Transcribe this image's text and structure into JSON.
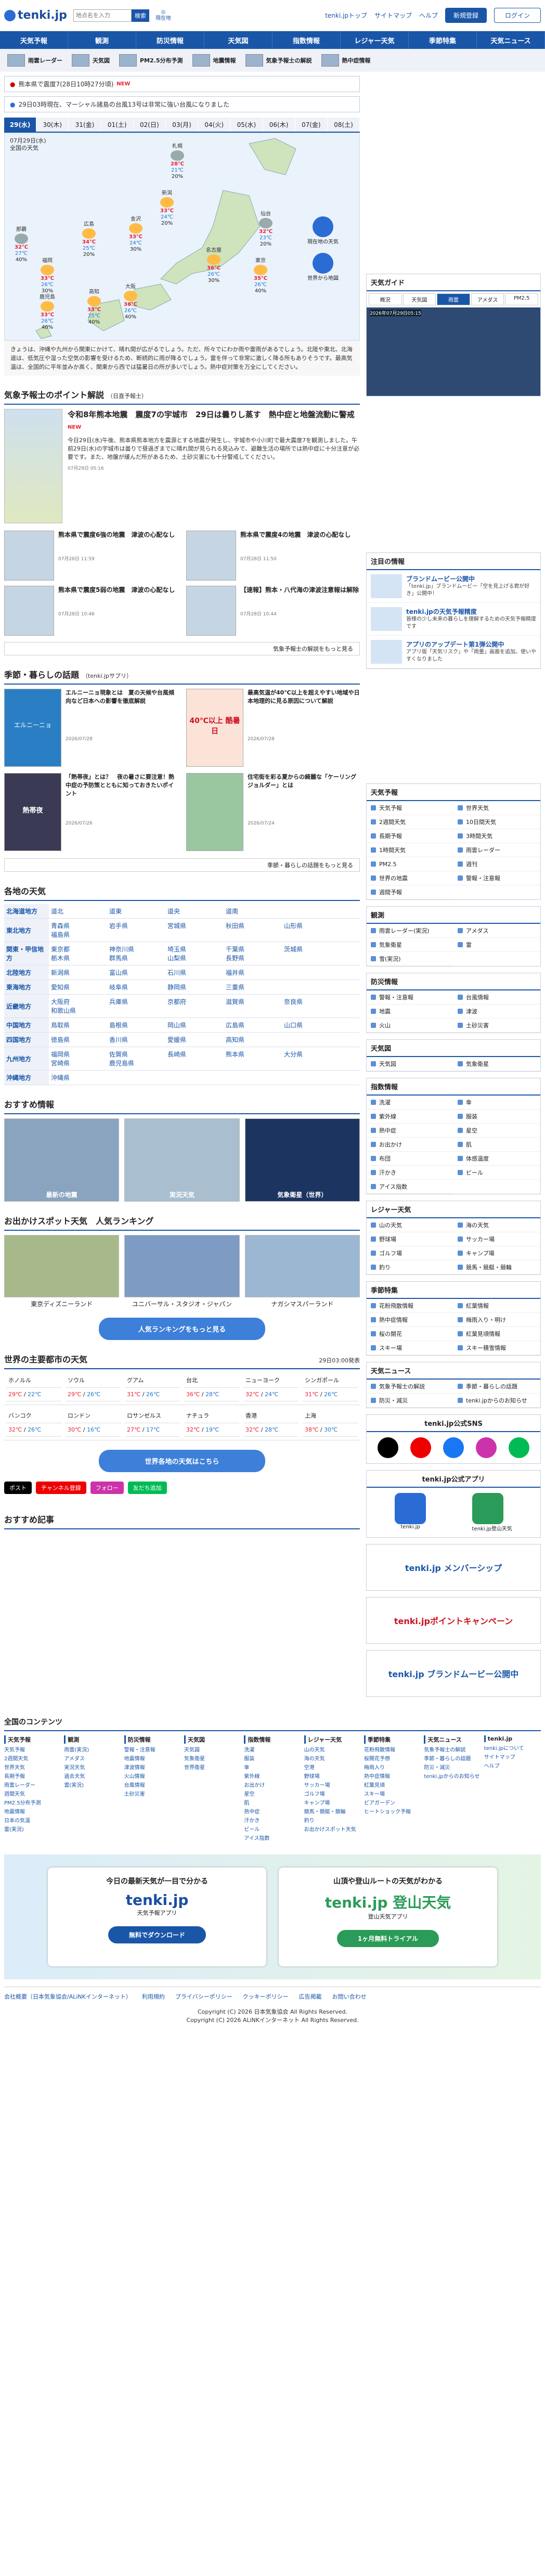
{
  "header": {
    "logo": "tenki.jp",
    "search_placeholder": "地点名を入力",
    "search_button": "検索",
    "current_location": "現在地",
    "links": [
      "tenki.jpトップ",
      "サイトマップ",
      "ヘルプ"
    ],
    "register": "新規登録",
    "login": "ログイン"
  },
  "nav": [
    "天気予報",
    "観測",
    "防災情報",
    "天気図",
    "指数情報",
    "レジャー天気",
    "季節特集",
    "天気ニュース"
  ],
  "subnav": [
    "雨雲レーダー",
    "天気図",
    "PM2.5分布予測",
    "地震情報",
    "気象予報士の解説",
    "熱中症情報"
  ],
  "alerts": [
    {
      "badge": "●",
      "text": "熊本県で震度7(28日10時27分頃)",
      "tag": "NEW"
    },
    {
      "badge": "●",
      "text": "29日03時現在、マーシャル諸島の台風13号は非常に強い台風になりました"
    }
  ],
  "day_tabs": [
    "29(水)",
    "30(木)",
    "31(金)",
    "01(土)",
    "02(日)",
    "03(月)",
    "04(火)",
    "05(水)",
    "06(木)",
    "07(金)",
    "08(土)"
  ],
  "map": {
    "title": "07月29日(水)",
    "subtitle": "全国の天気",
    "cities": [
      {
        "name": "札幌",
        "hi": "28℃",
        "lo": "21℃",
        "pop": "20%"
      },
      {
        "name": "新潟",
        "hi": "33℃",
        "lo": "24℃",
        "pop": "20%"
      },
      {
        "name": "仙台",
        "hi": "32℃",
        "lo": "23℃",
        "pop": "20%"
      },
      {
        "name": "金沢",
        "hi": "33℃",
        "lo": "24℃",
        "pop": "30%"
      },
      {
        "name": "広島",
        "hi": "34℃",
        "lo": "25℃",
        "pop": "20%"
      },
      {
        "name": "名古屋",
        "hi": "36℃",
        "lo": "26℃",
        "pop": "30%"
      },
      {
        "name": "東京",
        "hi": "35℃",
        "lo": "26℃",
        "pop": "40%"
      },
      {
        "name": "福岡",
        "hi": "33℃",
        "lo": "26℃",
        "pop": "30%"
      },
      {
        "name": "大阪",
        "hi": "36℃",
        "lo": "26℃",
        "pop": "40%"
      },
      {
        "name": "高知",
        "hi": "33℃",
        "lo": "25℃",
        "pop": "40%"
      },
      {
        "name": "鹿児島",
        "hi": "33℃",
        "lo": "26℃",
        "pop": "40%"
      },
      {
        "name": "那覇",
        "hi": "32℃",
        "lo": "27℃",
        "pop": "40%"
      }
    ],
    "btn_register": "現在地の天気",
    "btn_world": "世界から地図",
    "note": "きょうは、沖縄や九州から関東にかけて、晴れ間が広がるでしょう。ただ、所々でにわか雨や雷雨があるでしょう。北陸や東北、北海道は、低気圧や湿った空気の影響を受けるため、断続的に雨が降るでしょう。雷を伴って非常に激しく降る所もありそうです。最高気温は、全国的に平年並みか高く、関東から西では猛暑日の所が多いでしょう。熱中症対策を万全にしてください。"
  },
  "forecaster": {
    "title": "気象予報士のポイント解説",
    "sub": "（日直予報士）",
    "feature_title": "令和8年熊本地震　震度7の宇城市　29日は曇りし蒸す　熱中症と地盤流動に警戒",
    "feature_tag": "NEW",
    "feature_text": "今日29日(水)午後、熊本県熊本地方を震源とする地震が発生し、宇城市や小川町で最大震度7を観測しました。午前29日(水)の宇城市は曇りで昼過ぎまでに晴れ間が見られる見込みで、避難生活の場所では熱中症に十分注意が必要です。また、地盤が緩んだ所があるため、土砂災害にも十分警戒してください。",
    "feature_date": "07月29日 05:16",
    "items": [
      {
        "title": "熊本県で震度6強の地震　津波の心配なし",
        "date": "07月28日 11:59"
      },
      {
        "title": "熊本県で震度4の地震　津波の心配なし",
        "date": "07月28日 11:50"
      },
      {
        "title": "熊本県で震度5弱の地震　津波の心配なし",
        "date": "07月28日 10:46"
      },
      {
        "title": "【速報】熊本・八代海の津波注意報は解除",
        "date": "07月28日 10:44"
      }
    ],
    "more": "気象予報士の解説をもっと見る"
  },
  "seasonal": {
    "title": "季節・暮らしの話題",
    "sub": "（tenki.jpサプリ）",
    "items": [
      {
        "title": "エルニーニョ現象とは　夏の天候や台風傾向など日本への影響を徹底解説",
        "date": "2026/07/28"
      },
      {
        "title": "最高気温が40℃以上を超えやすい地域や日本地理的に見る原因について解説",
        "date": "2026/07/28"
      },
      {
        "title": "「熱帯夜」とは？　夜の暑さに要注意！熱中症の予防策とともに知っておきたいポイント",
        "date": "2026/07/26"
      },
      {
        "title": "住宅街を彩る夏からの綺麗な「ケーリングジョルダー」とは",
        "date": "2026/07/24"
      }
    ],
    "img_labels": [
      "エルニーニョ",
      "40℃以上 酷暑日",
      "熱帯夜",
      ""
    ],
    "more": "季節・暮らしの話題をもっと見る"
  },
  "regions": {
    "title": "各地の天気",
    "rows": [
      {
        "area": "北海道地方",
        "prefs": [
          "道北",
          "道東",
          "道央",
          "道南"
        ]
      },
      {
        "area": "東北地方",
        "prefs": [
          "青森県",
          "岩手県",
          "宮城県",
          "秋田県",
          "山形県",
          "福島県"
        ]
      },
      {
        "area": "関東・甲信地方",
        "prefs": [
          "東京都",
          "神奈川県",
          "埼玉県",
          "千葉県",
          "茨城県",
          "栃木県",
          "群馬県",
          "山梨県",
          "長野県"
        ]
      },
      {
        "area": "北陸地方",
        "prefs": [
          "新潟県",
          "富山県",
          "石川県",
          "福井県"
        ]
      },
      {
        "area": "東海地方",
        "prefs": [
          "愛知県",
          "岐阜県",
          "静岡県",
          "三重県"
        ]
      },
      {
        "area": "近畿地方",
        "prefs": [
          "大阪府",
          "兵庫県",
          "京都府",
          "滋賀県",
          "奈良県",
          "和歌山県"
        ]
      },
      {
        "area": "中国地方",
        "prefs": [
          "鳥取県",
          "島根県",
          "岡山県",
          "広島県",
          "山口県"
        ]
      },
      {
        "area": "四国地方",
        "prefs": [
          "徳島県",
          "香川県",
          "愛媛県",
          "高知県"
        ]
      },
      {
        "area": "九州地方",
        "prefs": [
          "福岡県",
          "佐賀県",
          "長崎県",
          "熊本県",
          "大分県",
          "宮崎県",
          "鹿児島県"
        ]
      },
      {
        "area": "沖縄地方",
        "prefs": [
          "沖縄県"
        ]
      }
    ]
  },
  "recommended": {
    "title": "おすすめ情報",
    "items": [
      "最新の地震",
      "実況天気",
      "気象衛星（世界）"
    ]
  },
  "spots": {
    "title": "お出かけスポット天気　人気ランキング",
    "items": [
      "東京ディズニーランド",
      "ユニバーサル・スタジオ・ジャパン",
      "ナガシマスパーランド"
    ],
    "more": "人気ランキングをもっと見る"
  },
  "world": {
    "title": "世界の主要都市の天気",
    "updated": "29日03:00発表",
    "cities": [
      {
        "name": "ホノルル",
        "hi": "29℃",
        "lo": "22℃"
      },
      {
        "name": "ソウル",
        "hi": "29℃",
        "lo": "26℃"
      },
      {
        "name": "グアム",
        "hi": "31℃",
        "lo": "26℃"
      },
      {
        "name": "台北",
        "hi": "36℃",
        "lo": "28℃"
      },
      {
        "name": "ニューヨーク",
        "hi": "32℃",
        "lo": "24℃"
      },
      {
        "name": "シンガポール",
        "hi": "31℃",
        "lo": "26℃"
      },
      {
        "name": "バンコク",
        "hi": "32℃",
        "lo": "26℃"
      },
      {
        "name": "ロンドン",
        "hi": "30℃",
        "lo": "16℃"
      },
      {
        "name": "ロサンゼルス",
        "hi": "27℃",
        "lo": "17℃"
      },
      {
        "name": "ナチュラ",
        "hi": "32℃",
        "lo": "19℃"
      },
      {
        "name": "香港",
        "hi": "32℃",
        "lo": "28℃"
      },
      {
        "name": "上海",
        "hi": "38℃",
        "lo": "30℃"
      }
    ],
    "more": "世界各地の天気はこちら",
    "sns": [
      "ポスト",
      "チャンネル登録",
      "フォロー",
      "友だち追加"
    ]
  },
  "recommended_articles": "おすすめ記事",
  "side": {
    "guide_title": "天気ガイド",
    "guide_tabs": [
      "概況",
      "天気図",
      "雨雲",
      "アメダス",
      "PM2.5"
    ],
    "guide_time": "2026年07月29日05:15",
    "notices_title": "注目の情報",
    "notices": [
      {
        "title": "ブランドムービー公開中",
        "text": "「tenki.jp」ブランドムービー「空を見上げる君が好き」公開中！"
      },
      {
        "title": "tenki.jpの天気予報精度",
        "text": "皆様の少し未来の暮らしを理解するための天気予報精度です"
      },
      {
        "title": "アプリのアップデート第1弾公開中",
        "text": "アプリ版「天気リスク」や「雨量」画面を追加。使いやすくなりました"
      }
    ],
    "groups": [
      {
        "title": "天気予報",
        "items": [
          "天気予報",
          "世界天気",
          "2週間天気",
          "10日間天気",
          "長期予報",
          "3時間天気",
          "1時間天気",
          "雨雲レーダー",
          "PM2.5",
          "週刊",
          "世界の地震",
          "警報・注意報",
          "週間予報"
        ]
      },
      {
        "title": "観測",
        "items": [
          "雨雲レーダー(実況)",
          "アメダス",
          "気象衛星",
          "雷",
          "雪(実況)"
        ]
      },
      {
        "title": "防災情報",
        "items": [
          "警報・注意報",
          "台風情報",
          "地震",
          "津波",
          "火山",
          "土砂災害"
        ]
      },
      {
        "title": "天気図",
        "items": [
          "天気図",
          "気象衛星"
        ]
      },
      {
        "title": "指数情報",
        "items": [
          "洗濯",
          "傘",
          "紫外線",
          "服装",
          "熱中症",
          "星空",
          "お出かけ",
          "肌",
          "布団",
          "体感温度",
          "汗かき",
          "ビール",
          "アイス指数"
        ]
      },
      {
        "title": "レジャー天気",
        "items": [
          "山の天気",
          "海の天気",
          "野球場",
          "サッカー場",
          "ゴルフ場",
          "キャンプ場",
          "釣り",
          "競馬・競艇・競輪"
        ]
      },
      {
        "title": "季節特集",
        "items": [
          "花粉飛散情報",
          "紅葉情報",
          "熱中症情報",
          "梅雨入り・明け",
          "桜の開花",
          "紅葉見頃情報",
          "スキー場",
          "スキー積雪情報"
        ]
      },
      {
        "title": "天気ニュース",
        "items": [
          "気象予報士の解説",
          "季節・暮らしの話題",
          "防災・減災",
          "tenki.jpからのお知らせ"
        ]
      }
    ],
    "sns_title": "tenki.jp公式SNS",
    "app_title": "tenki.jp公式アプリ",
    "apps": [
      "tenki.jp",
      "tenki.jp登山天気"
    ],
    "banners": [
      "tenki.jp メンバーシップ",
      "tenki.jpポイントキャンペーン",
      "tenki.jp ブランドムービー公開中"
    ]
  },
  "all_contents": {
    "title": "全国のコンテンツ",
    "cols": [
      {
        "h": "天気予報",
        "items": [
          "天気予報",
          "2週間天気",
          "世界天気",
          "長期予報",
          "雨雲レーダー",
          "週間天気",
          "PM2.5分布予測",
          "地震情報",
          "日本の気温",
          "雷(実況)"
        ]
      },
      {
        "h": "観測",
        "items": [
          "雨雲(実況)",
          "アメダス",
          "実況天気",
          "過去天気",
          "雲(実況)"
        ]
      },
      {
        "h": "防災情報",
        "items": [
          "警報・注意報",
          "地震情報",
          "津波情報",
          "火山情報",
          "台風情報",
          "土砂災害"
        ]
      },
      {
        "h": "天気図",
        "items": [
          "天気図",
          "気象衛星",
          "世界衛星"
        ]
      },
      {
        "h": "指数情報",
        "items": [
          "洗濯",
          "服装",
          "傘",
          "紫外線",
          "お出かけ",
          "星空",
          "肌",
          "熱中症",
          "汗かき",
          "ビール",
          "アイス指数"
        ]
      },
      {
        "h": "レジャー天気",
        "items": [
          "山の天気",
          "海の天気",
          "空港",
          "野球場",
          "サッカー場",
          "ゴルフ場",
          "キャンプ場",
          "競馬・競艇・競輪",
          "釣り",
          "お出かけスポット天気"
        ]
      },
      {
        "h": "季節特集",
        "items": [
          "花粉飛散情報",
          "桜開花予想",
          "梅雨入り",
          "熱中症情報",
          "紅葉見頃",
          "スキー場",
          "ビアガーデン",
          "ヒートショック予報"
        ]
      },
      {
        "h": "天気ニュース",
        "items": [
          "気象予報士の解説",
          "季節・暮らしの話題",
          "防災・減災",
          "tenki.jpからのお知らせ"
        ]
      },
      {
        "h": "tenki.jp",
        "items": [
          "tenki.jpについて",
          "サイトマップ",
          "ヘルプ"
        ]
      }
    ]
  },
  "app_banner": [
    {
      "head": "今日の最新天気が一目で分かる",
      "logo": "tenki.jp",
      "sub": "天気予報アプリ",
      "btn": "無料でダウンロード"
    },
    {
      "head": "山頂や登山ルートの天気がわかる",
      "logo": "tenki.jp 登山天気",
      "sub": "登山天気アプリ",
      "btn": "1ヶ月無料トライアル"
    }
  ],
  "footer": {
    "links": [
      "会社概要（日本気象協会/ALiNKインターネット）",
      "利用規約",
      "プライバシーポリシー",
      "クッキーポリシー",
      "広告掲載",
      "お問い合わせ"
    ],
    "copy1": "Copyright (C) 2026 日本気象協会 All Rights Reserved.",
    "copy2": "Copyright (C) 2026 ALiNKインターネット All Rights Reserved."
  },
  "colors": {
    "brand": "#1a56a8",
    "hot": "#e22233",
    "cold": "#2277cc"
  }
}
